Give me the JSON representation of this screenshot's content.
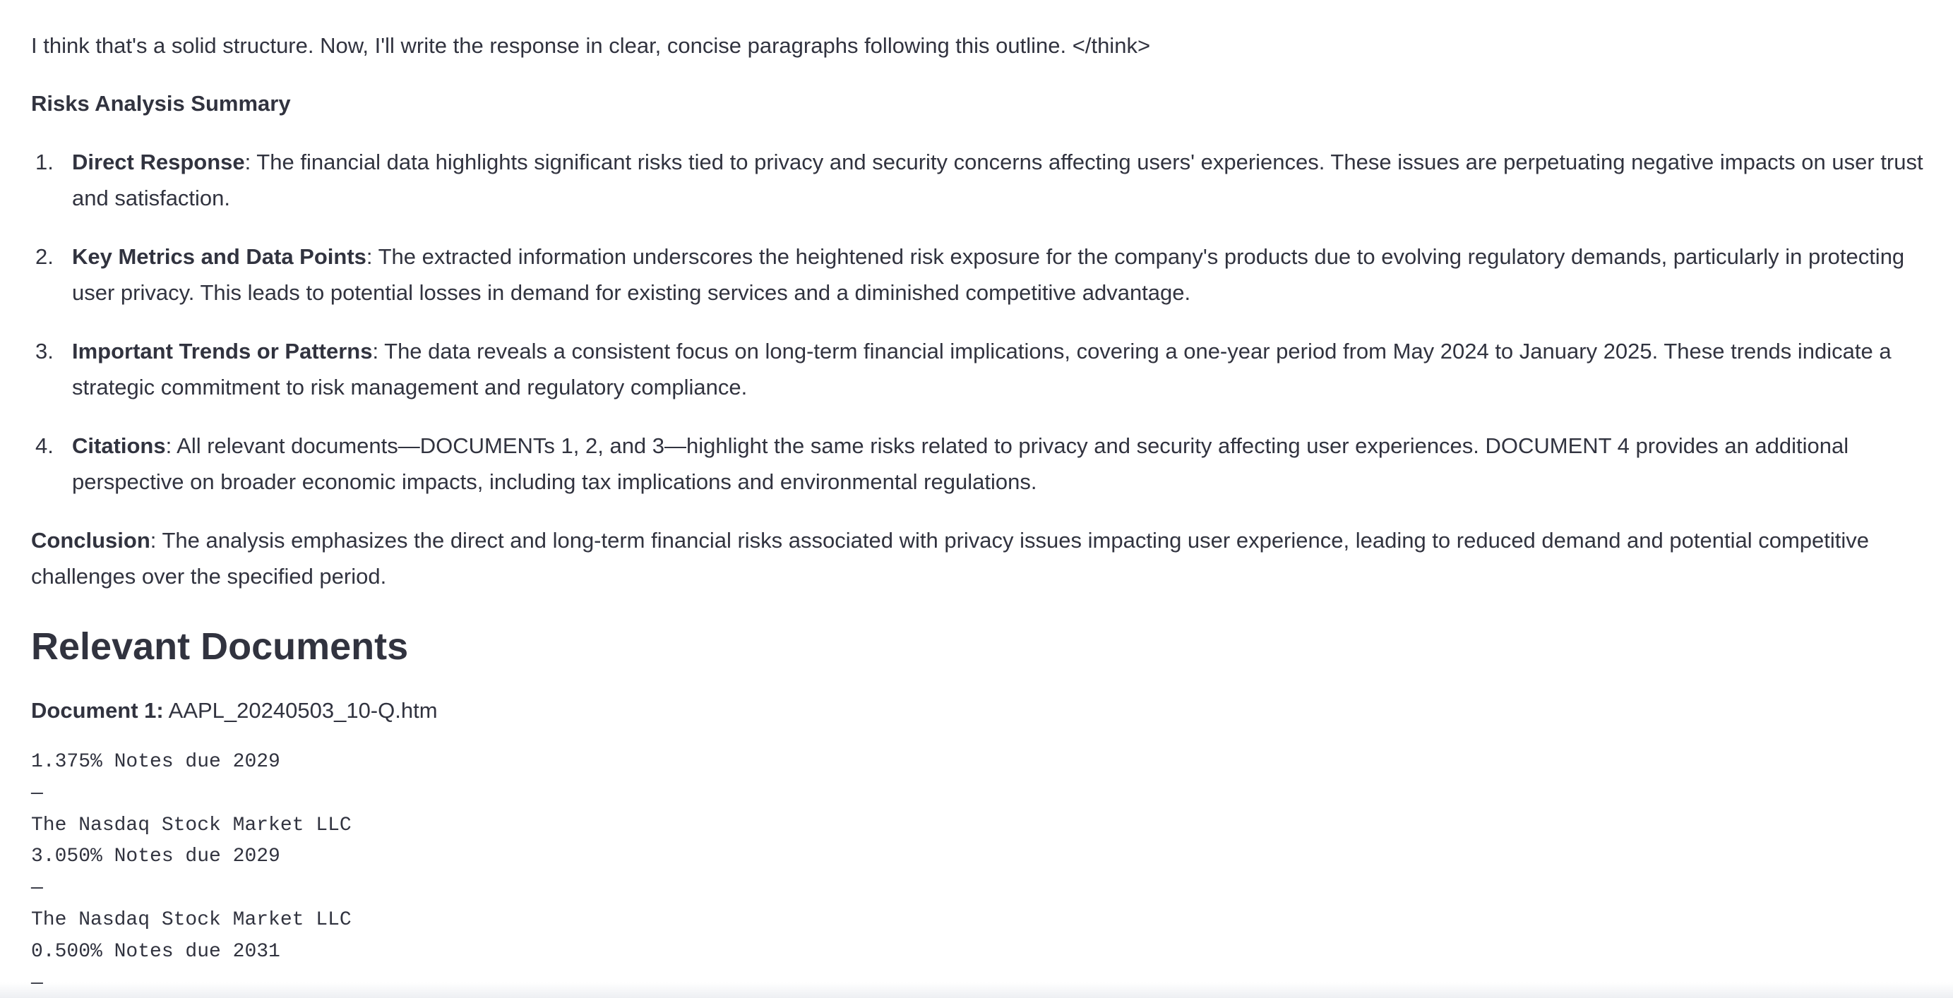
{
  "think_tail": "I think that's a solid structure. Now, I'll write the response in clear, concise paragraphs following this outline. </think>",
  "summary_heading": "Risks Analysis Summary",
  "points": [
    {
      "number": "1.",
      "label": "Direct Response",
      "text": ": The financial data highlights significant risks tied to privacy and security concerns affecting users' experiences. These issues are perpetuating negative impacts on user trust and satisfaction."
    },
    {
      "number": "2.",
      "label": "Key Metrics and Data Points",
      "text": ": The extracted information underscores the heightened risk exposure for the company's products due to evolving regulatory demands, particularly in protecting user privacy. This leads to potential losses in demand for existing services and a diminished competitive advantage."
    },
    {
      "number": "3.",
      "label": "Important Trends or Patterns",
      "text": ": The data reveals a consistent focus on long-term financial implications, covering a one-year period from May 2024 to January 2025. These trends indicate a strategic commitment to risk management and regulatory compliance."
    },
    {
      "number": "4.",
      "label": "Citations",
      "text": ": All relevant documents—DOCUMENTs 1, 2, and 3—highlight the same risks related to privacy and security affecting user experiences. DOCUMENT 4 provides an additional perspective on broader economic impacts, including tax implications and environmental regulations."
    }
  ],
  "conclusion": {
    "label": "Conclusion",
    "text": ": The analysis emphasizes the direct and long-term financial risks associated with privacy issues impacting user experience, leading to reduced demand and potential competitive challenges over the specified period."
  },
  "relevant_heading": "Relevant Documents",
  "document": {
    "label": "Document 1:",
    "filename": " AAPL_20240503_10-Q.htm",
    "lines": [
      "1.375% Notes due 2029",
      "—",
      "The Nasdaq Stock Market LLC",
      "3.050% Notes due 2029",
      "—",
      "The Nasdaq Stock Market LLC",
      "0.500% Notes due 2031",
      "—"
    ]
  }
}
